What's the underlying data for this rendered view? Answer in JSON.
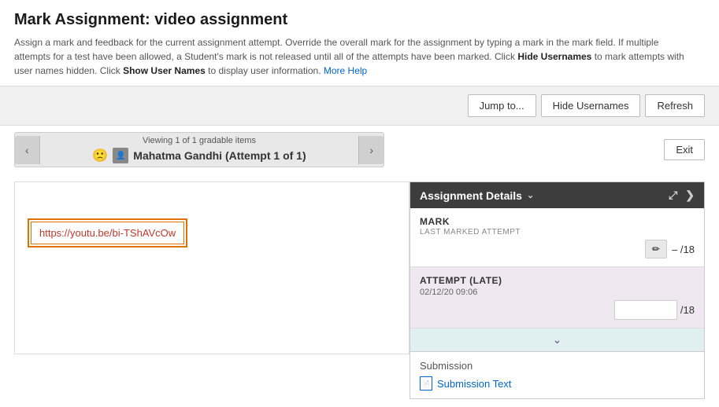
{
  "page": {
    "title": "Mark Assignment: video assignment",
    "description_parts": [
      "Assign a mark and feedback for the current assignment attempt. Override the overall mark for the assignment by typing a mark in the mark field. If multiple attempts for a test have been allowed, a Student's mark is not released until all of the attempts have been marked. Click ",
      "Hide Usernames",
      " to mark attempts with user names hidden. Click ",
      "Show User Names",
      " to display user information. ",
      "More Help"
    ]
  },
  "toolbar": {
    "jump_to_label": "Jump to...",
    "hide_usernames_label": "Hide Usernames",
    "refresh_label": "Refresh"
  },
  "nav": {
    "viewing_text": "Viewing 1 of 1 gradable items",
    "student_name": "Mahatma Gandhi (Attempt 1 of 1)",
    "exit_label": "Exit"
  },
  "submission": {
    "link_url": "https://youtu.be/bi-TShAVcOw",
    "link_text": "https://youtu.be/bi-TShAVcOw"
  },
  "assignment_details": {
    "header_label": "Assignment Details",
    "expand_icon": "⤢",
    "next_icon": "❯",
    "mark": {
      "label": "MARK",
      "sub_label": "LAST MARKED ATTEMPT",
      "score_text": "– /18"
    },
    "attempt": {
      "label": "ATTEMPT (LATE)",
      "date": "02/12/20 09:06",
      "max_score": "/18"
    },
    "submission_section": {
      "label": "Submission",
      "text_link": "Submission Text"
    }
  }
}
